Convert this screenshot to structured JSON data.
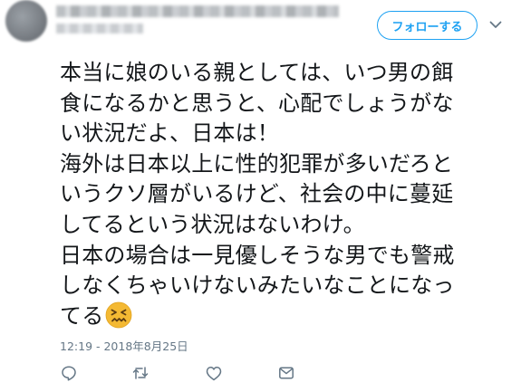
{
  "header": {
    "follow_label": "フォローする"
  },
  "tweet": {
    "lines": [
      "本当に娘のいる親としては、いつ男の餌",
      "食になるかと思うと、心配でしょうがな",
      "い状況だよ、日本は！",
      "海外は日本以上に性的犯罪が多いだろと",
      "いうクソ層がいるけど、社会の中に蔓延",
      "してるという状況はないわけ。",
      "日本の場合は一見優しそうな男でも警戒",
      "しなくちゃいけないみたいなことになっ",
      "てる"
    ],
    "emoji": "confounded-face",
    "timestamp": "12:19 - 2018年8月25日"
  },
  "actions": {
    "icons": [
      "reply-icon",
      "retweet-icon",
      "like-icon",
      "message-icon"
    ]
  },
  "colors": {
    "accent": "#1da1f2",
    "text": "#14171a",
    "muted": "#657786",
    "emoji_yellow": "#f4b933"
  }
}
